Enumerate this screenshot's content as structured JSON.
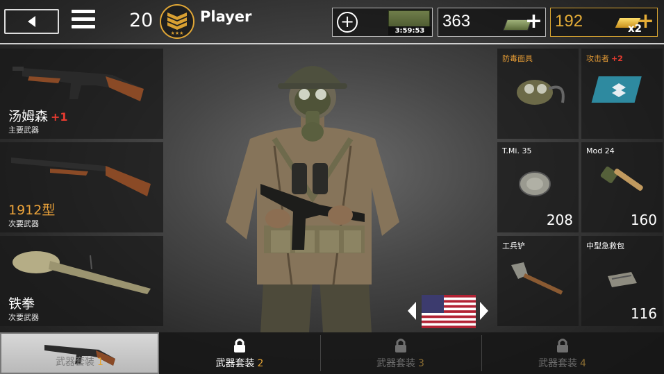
{
  "header": {
    "level": "20",
    "player_name": "Player",
    "crate_timer": "3:59:53",
    "cash": "363",
    "gold": "192",
    "gold_multiplier": "x2"
  },
  "weapons": [
    {
      "name": "汤姆森",
      "bonus": "+1",
      "slot": "主要武器"
    },
    {
      "name": "1912型",
      "bonus": "",
      "slot": "次要武器"
    },
    {
      "name": "铁拳",
      "bonus": "",
      "slot": "次要武器"
    }
  ],
  "items": [
    {
      "name": "防毒面具",
      "bonus": "",
      "count": ""
    },
    {
      "name": "攻击者",
      "bonus": "+2",
      "count": ""
    },
    {
      "name": "T.Mi. 35",
      "bonus": "",
      "count": "208"
    },
    {
      "name": "Mod 24",
      "bonus": "",
      "count": "160"
    },
    {
      "name": "工兵铲",
      "bonus": "",
      "count": ""
    },
    {
      "name": "中型急救包",
      "bonus": "",
      "count": "116"
    }
  ],
  "tabs": [
    {
      "label": "武器套装",
      "num": "1",
      "state": "active"
    },
    {
      "label": "武器套装",
      "num": "2",
      "state": "locked"
    },
    {
      "label": "武器套装",
      "num": "3",
      "state": "locked-dim"
    },
    {
      "label": "武器套装",
      "num": "4",
      "state": "locked-dim"
    }
  ],
  "colors": {
    "accent_gold": "#e5ad37",
    "bonus_red": "#e83b30",
    "item_orange": "#e49b35"
  },
  "icons": [
    "back-arrow-icon",
    "menu-icon",
    "rank-chevron-icon",
    "add-circle-icon",
    "supply-crate-icon",
    "cash-stack-icon",
    "gold-bar-icon",
    "lock-icon",
    "usa-flag-icon"
  ]
}
